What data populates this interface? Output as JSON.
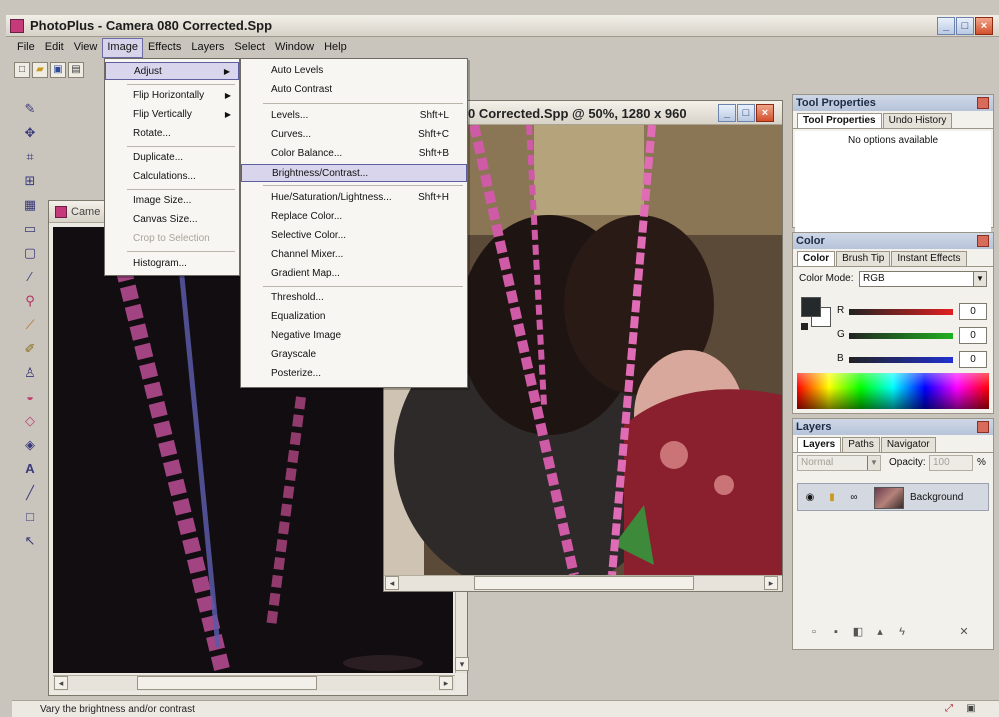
{
  "window": {
    "title": "PhotoPlus - Camera 080 Corrected.Spp",
    "minimize": "_",
    "maximize": "□",
    "close": "×"
  },
  "menubar": [
    "File",
    "Edit",
    "View",
    "Image",
    "Effects",
    "Layers",
    "Select",
    "Window",
    "Help"
  ],
  "toolbar_icons": [
    "new-icon",
    "open-icon",
    "save-icon",
    "print-icon"
  ],
  "tools": [
    "straighten-icon",
    "move-icon",
    "crop-icon",
    "deform-icon",
    "mesh-icon",
    "selection-icon",
    "shape-select-icon",
    "magic-wand-icon",
    "dropper-icon",
    "brush-icon",
    "pencil-icon",
    "clone-icon",
    "eraser-icon",
    "paint-icon",
    "fill-icon",
    "text-icon",
    "line-icon",
    "rectangle-icon",
    "pointer-icon"
  ],
  "doc_back": {
    "title": "Came"
  },
  "doc_front": {
    "title": "0 Corrected.Spp @ 50%, 1280 x 960"
  },
  "image_menu": {
    "adjust": "Adjust",
    "flip_h": "Flip Horizontally",
    "flip_v": "Flip Vertically",
    "rotate": "Rotate...",
    "duplicate": "Duplicate...",
    "calculations": "Calculations...",
    "image_size": "Image Size...",
    "canvas_size": "Canvas Size...",
    "crop_selection": "Crop to Selection",
    "histogram": "Histogram..."
  },
  "adjust_menu": {
    "auto_levels": "Auto Levels",
    "auto_contrast": "Auto Contrast",
    "levels": "Levels...",
    "levels_sc": "Shft+L",
    "curves": "Curves...",
    "curves_sc": "Shft+C",
    "color_balance": "Color Balance...",
    "color_balance_sc": "Shft+B",
    "brightness": "Brightness/Contrast...",
    "hue": "Hue/Saturation/Lightness...",
    "hue_sc": "Shft+H",
    "replace_color": "Replace Color...",
    "selective_color": "Selective Color...",
    "channel_mixer": "Channel Mixer...",
    "gradient_map": "Gradient Map...",
    "threshold": "Threshold...",
    "equalization": "Equalization",
    "negative": "Negative Image",
    "grayscale": "Grayscale",
    "posterize": "Posterize..."
  },
  "tool_properties": {
    "header": "Tool Properties",
    "tab1": "Tool Properties",
    "tab2": "Undo History",
    "body": "No options available"
  },
  "color_panel": {
    "header": "Color",
    "tab1": "Color",
    "tab2": "Brush Tip",
    "tab3": "Instant Effects",
    "mode_label": "Color Mode:",
    "mode_value": "RGB",
    "r_label": "R",
    "r_value": "0",
    "g_label": "G",
    "g_value": "0",
    "b_label": "B",
    "b_value": "0"
  },
  "layers_panel": {
    "header": "Layers",
    "tab1": "Layers",
    "tab2": "Paths",
    "tab3": "Navigator",
    "blend": "Normal",
    "opacity_label": "Opacity:",
    "opacity_value": "100",
    "pct": "%",
    "layer_name": "Background"
  },
  "status": {
    "text": "Vary the brightness and/or contrast"
  }
}
